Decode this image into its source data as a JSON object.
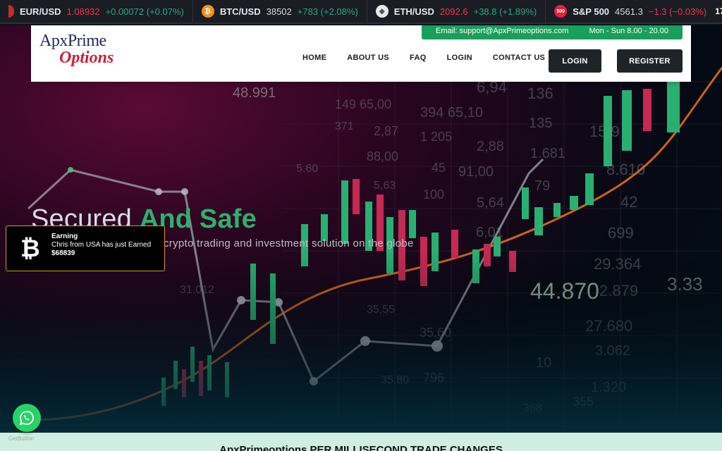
{
  "ticker": [
    {
      "symbol": "EUR/USD",
      "price": "1.08932",
      "change": "+0.00072 (+0.07%)",
      "direction": "up",
      "price_color": "#f23645",
      "logo": "flag-icon",
      "logo_color": "#d33"
    },
    {
      "symbol": "BTC/USD",
      "price": "38502",
      "change": "+783 (+2.08%)",
      "direction": "up",
      "price_color": "#d8dbe0",
      "logo": "bitcoin-icon",
      "logo_color": "#f7931a"
    },
    {
      "symbol": "ETH/USD",
      "price": "2092.6",
      "change": "+38.8 (+1.89%)",
      "direction": "up",
      "price_color": "#f23645",
      "logo": "ethereum-icon",
      "logo_color": "#e8e8e8"
    },
    {
      "symbol": "S&P 500",
      "price": "4561.3",
      "change": "−1.3 (−0.03%)",
      "direction": "down",
      "price_color": "#d8dbe0",
      "logo": "sp500-icon",
      "logo_color": "#e0243a",
      "logo_text": "500"
    }
  ],
  "contact": {
    "email": "Email: support@ApxPrimeoptions.com",
    "hours": "Mon - Sun 8.00 - 20.00"
  },
  "logo": {
    "top": "ApxPrime",
    "bottom": "Options"
  },
  "nav": [
    {
      "label": "HOME"
    },
    {
      "label": "ABOUT US"
    },
    {
      "label": "FAQ"
    },
    {
      "label": "LOGIN"
    },
    {
      "label": "CONTACT US"
    }
  ],
  "buttons": {
    "login": "LOGIN",
    "register": "REGISTER"
  },
  "hero": {
    "headline_plain": "Secured ",
    "headline_accent": "And Safe",
    "subline": "crypto trading and investment solution on the globe"
  },
  "popup": {
    "title": "Earning",
    "message": "Chris from USA has just Earned",
    "amount": "$68839"
  },
  "getbutton": "GetButton",
  "bottom_title": "ApxPrimeoptions PER MILLISECOND TRADE CHANGES",
  "colors": {
    "accent_green": "#2eb06c",
    "contact_bar": "#16a05a",
    "popup_border": "#d49a2a",
    "whatsapp": "#25d366"
  }
}
